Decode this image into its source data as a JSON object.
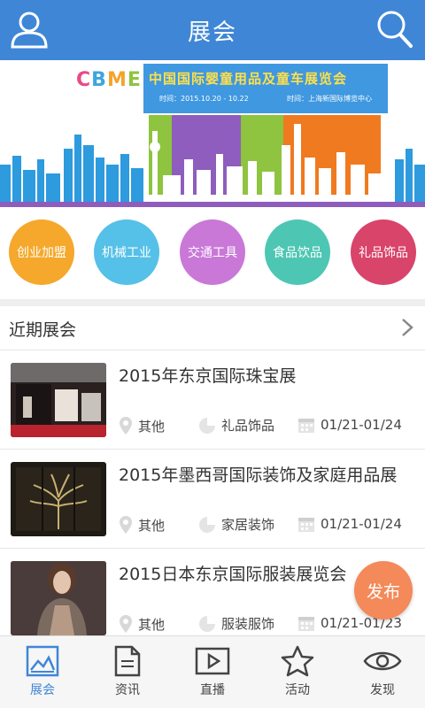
{
  "header": {
    "title": "展会"
  },
  "banner": {
    "logo": "CBME",
    "headline": "中国国际婴童用品及童车展览会",
    "time_line": "时间：2015.10.20 - 10.22",
    "place_line": "时间：上海新国际博览中心"
  },
  "categories": [
    "创业加盟",
    "机械工业",
    "交通工具",
    "食品饮品",
    "礼品饰品"
  ],
  "section": {
    "title": "近期展会"
  },
  "items": [
    {
      "title": "2015年东京国际珠宝展",
      "location": "其他",
      "category": "礼品饰品",
      "date": "01/21-01/24"
    },
    {
      "title": "2015年墨西哥国际装饰及家庭用品展",
      "location": "其他",
      "category": "家居装饰",
      "date": "01/21-01/24"
    },
    {
      "title": "2015日本东京国际服装展览会",
      "location": "其他",
      "category": "服装服饰",
      "date": "01/21-01/23"
    }
  ],
  "fab": {
    "label": "发布"
  },
  "nav": [
    {
      "label": "展会",
      "icon": "image-icon"
    },
    {
      "label": "资讯",
      "icon": "document-icon"
    },
    {
      "label": "直播",
      "icon": "play-icon"
    },
    {
      "label": "活动",
      "icon": "star-icon"
    },
    {
      "label": "发现",
      "icon": "eye-icon"
    }
  ],
  "colors": {
    "header": "#3f86d6",
    "accent": "#f4895a"
  }
}
